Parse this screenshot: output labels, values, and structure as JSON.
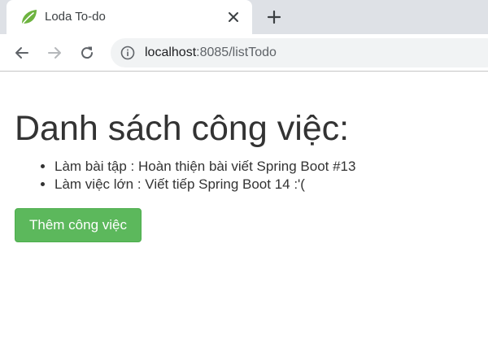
{
  "browser": {
    "tab": {
      "title": "Loda To-do",
      "favicon": "spring-leaf-icon"
    },
    "url": {
      "host": "localhost",
      "rest": ":8085/listTodo"
    }
  },
  "page": {
    "title": "Danh sách công việc:",
    "todos": [
      "Làm bài tập : Hoàn thiện bài viết Spring Boot #13",
      "Làm việc lớn : Viết tiếp Spring Boot 14 :'("
    ],
    "add_button_label": "Thêm công việc"
  },
  "colors": {
    "button": "#5cb85c",
    "favicon": "#6db33f",
    "tabstrip": "#dee1e6",
    "text": "#333333"
  }
}
